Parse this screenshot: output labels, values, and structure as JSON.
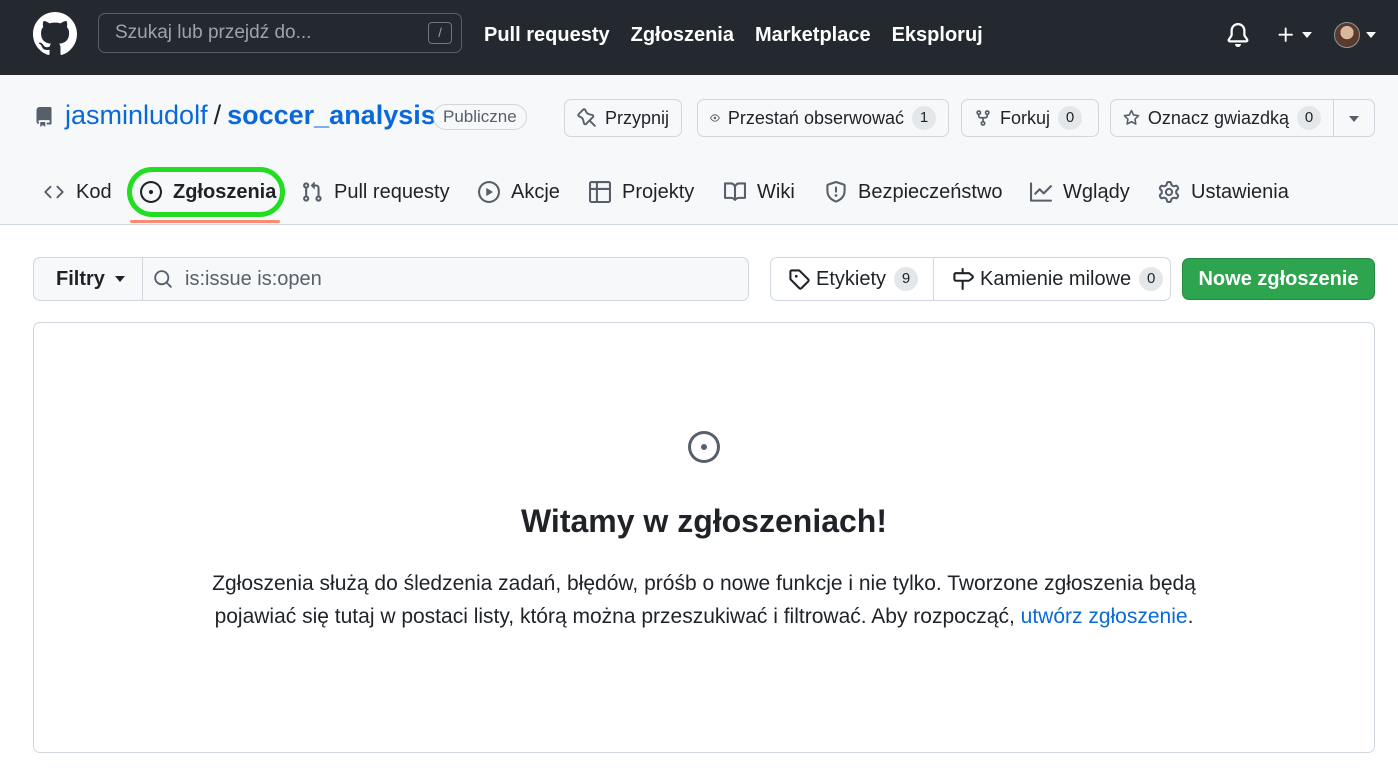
{
  "header": {
    "search_placeholder": "Szukaj lub przejdź do...",
    "search_shortcut": "/",
    "nav": [
      "Pull requesty",
      "Zgłoszenia",
      "Marketplace",
      "Eksploruj"
    ]
  },
  "repo": {
    "owner": "jasminludolf",
    "separator": "/",
    "name": "soccer_analysis",
    "visibility": "Publiczne",
    "actions": {
      "pin": "Przypnij",
      "unwatch": "Przestań obserwować",
      "unwatch_count": "1",
      "fork": "Forkuj",
      "fork_count": "0",
      "star": "Oznacz gwiazdką",
      "star_count": "0"
    },
    "tabs": {
      "code": "Kod",
      "issues": "Zgłoszenia",
      "pulls": "Pull requesty",
      "actions": "Akcje",
      "projects": "Projekty",
      "wiki": "Wiki",
      "security": "Bezpieczeństwo",
      "insights": "Wglądy",
      "settings": "Ustawienia"
    },
    "selected_tab": "issues"
  },
  "issues": {
    "filter_label": "Filtry",
    "search_value": "is:issue is:open",
    "labels_label": "Etykiety",
    "labels_count": "9",
    "milestones_label": "Kamienie milowe",
    "milestones_count": "0",
    "new_issue_label": "Nowe zgłoszenie"
  },
  "blankslate": {
    "title": "Witamy w zgłoszeniach!",
    "text_line1": "Zgłoszenia służą do śledzenia zadań, błędów, próśb o nowe funkcje i nie tylko. Tworzone zgłoszenia będą",
    "text_line2": "pojawiać się tutaj w postaci listy, którą można przeszukiwać i filtrować. Aby rozpocząć, ",
    "link_text": "utwórz zgłoszenie",
    "text_end": "."
  },
  "colors": {
    "header_bg": "#24292f",
    "link": "#0969da",
    "primary_button": "#2da44e",
    "tab_underline": "#fd8c73",
    "highlight_ring": "#22dd22"
  },
  "icons": [
    "github-logo-icon",
    "bell-icon",
    "plus-icon",
    "repo-icon",
    "pin-icon",
    "eye-icon",
    "fork-icon",
    "star-icon",
    "code-icon",
    "issue-opened-icon",
    "pull-request-icon",
    "play-icon",
    "table-icon",
    "book-icon",
    "shield-icon",
    "graph-icon",
    "gear-icon",
    "search-icon",
    "tag-icon",
    "milestone-icon"
  ]
}
